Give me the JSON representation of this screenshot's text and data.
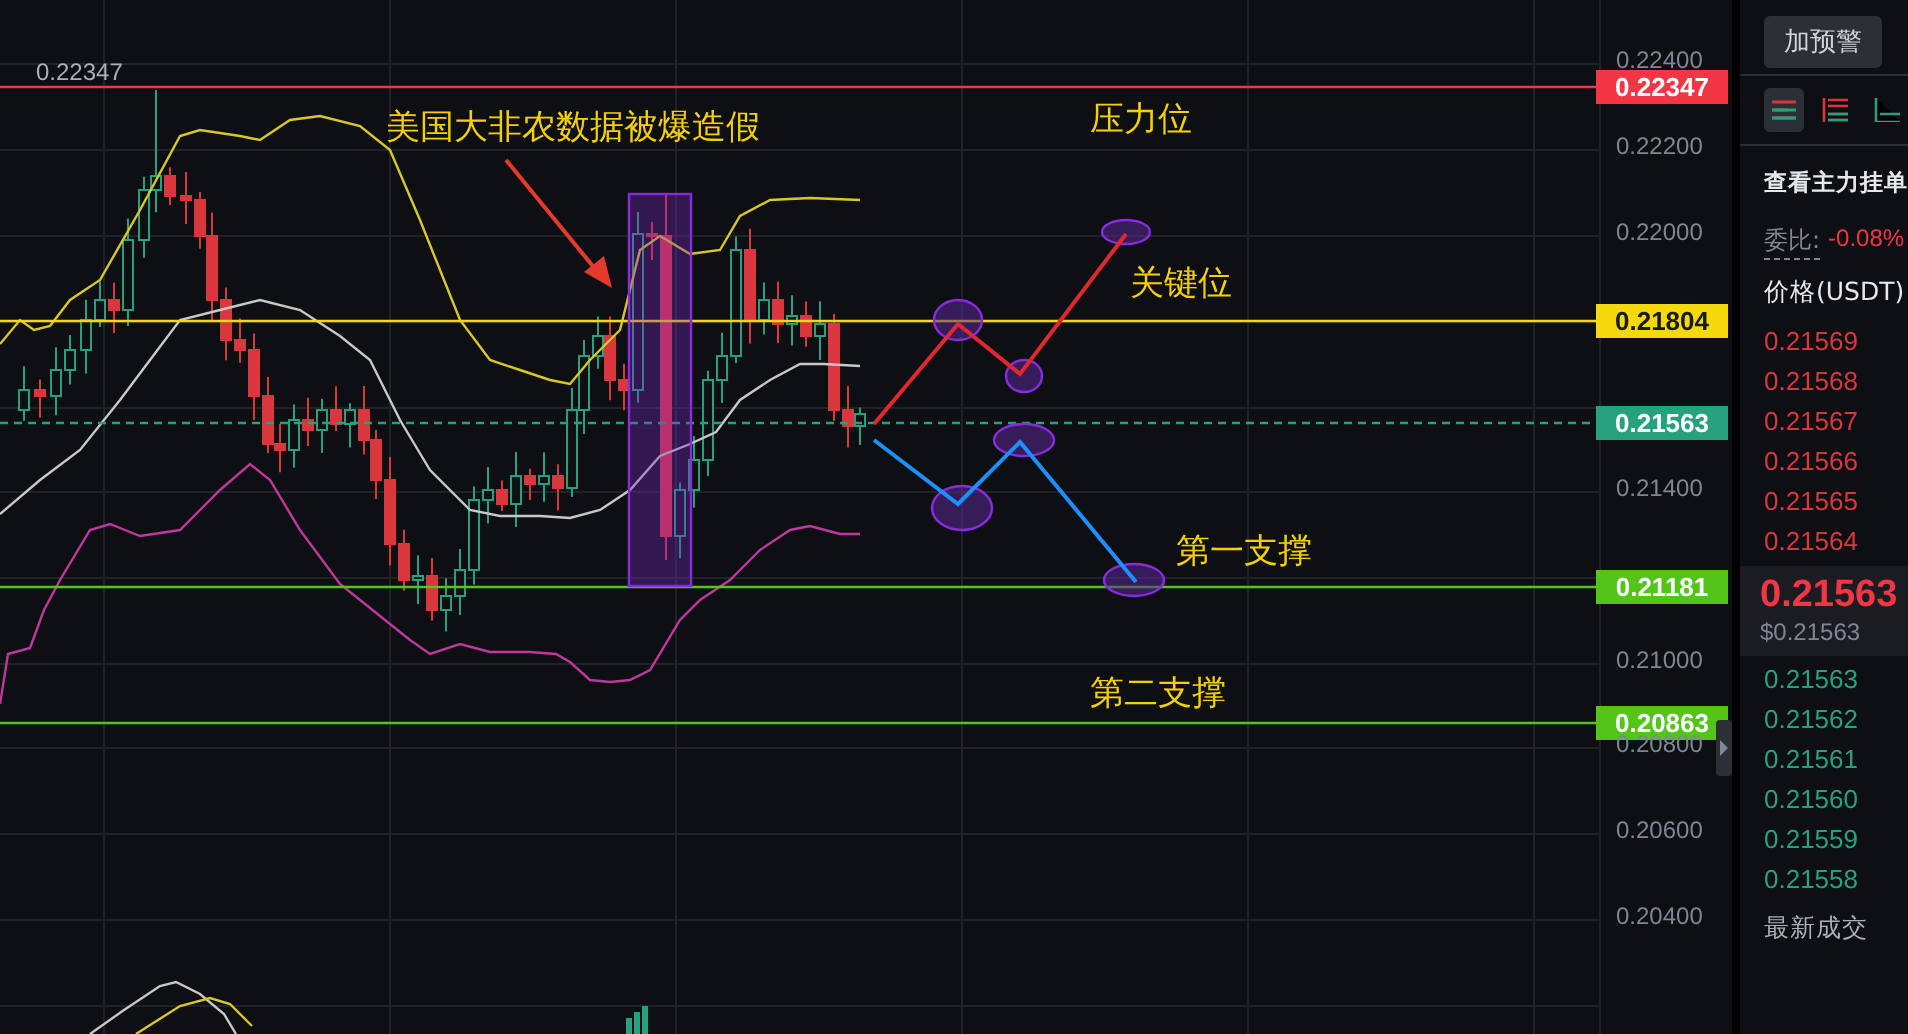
{
  "chart": {
    "high_marker": "0.22347",
    "axis_labels": [
      "0.22400",
      "0.22200",
      "0.22000",
      "0.21400",
      "0.21000",
      "0.20800",
      "0.20600",
      "0.20400"
    ],
    "price_lines": [
      {
        "price": "0.22347",
        "color": "#f23645",
        "kind": "solid"
      },
      {
        "price": "0.21804",
        "color": "#f5d90a",
        "kind": "solid"
      },
      {
        "price": "0.21563",
        "color": "#26a17b",
        "kind": "dashed"
      },
      {
        "price": "0.21181",
        "color": "#52c41a",
        "kind": "solid"
      },
      {
        "price": "0.20863",
        "color": "#52c41a",
        "kind": "solid"
      }
    ],
    "annotations": [
      {
        "text": "美国大非农数据被爆造假"
      },
      {
        "text": "压力位"
      },
      {
        "text": "关键位"
      },
      {
        "text": "第一支撑"
      },
      {
        "text": "第二支撑"
      }
    ]
  },
  "order_panel": {
    "alert_button": "加预警",
    "view_tabs": [
      {
        "selected": true
      },
      {
        "selected": false
      },
      {
        "selected": false
      }
    ],
    "main_orders_link": "查看主力挂单",
    "ratio_label": "委比:",
    "ratio_value": "-0.08%",
    "price_header": "价格(USDT)",
    "asks": [
      "0.21569",
      "0.21568",
      "0.21567",
      "0.21566",
      "0.21565",
      "0.21564"
    ],
    "last_price": "0.21563",
    "last_price_usd": "$0.21563",
    "bids": [
      "0.21563",
      "0.21562",
      "0.21561",
      "0.21560",
      "0.21559",
      "0.21558"
    ],
    "recent_trades_tab": "最新成交"
  }
}
